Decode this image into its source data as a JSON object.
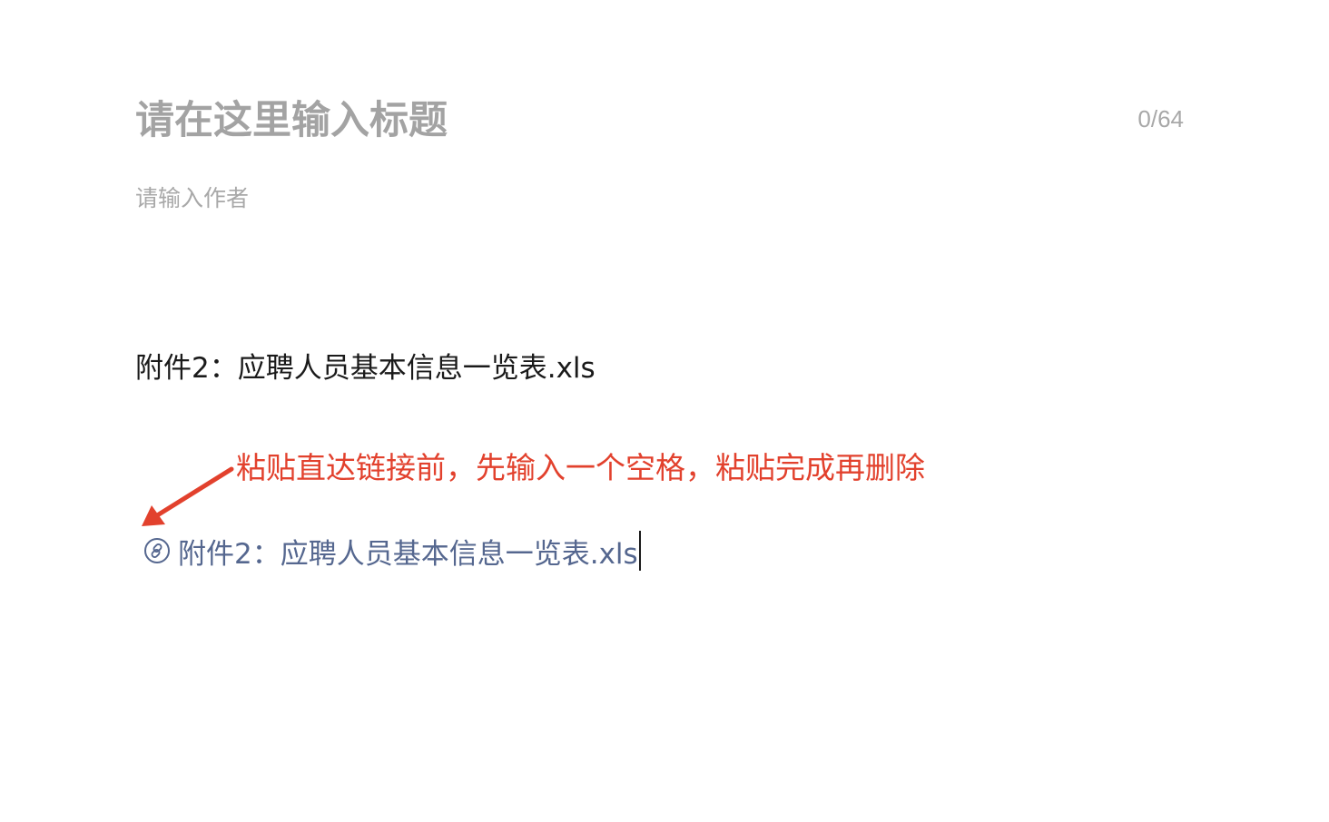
{
  "title_field": {
    "placeholder": "请在这里输入标题",
    "value": "",
    "counter": "0/64"
  },
  "author_field": {
    "placeholder": "请输入作者",
    "value": ""
  },
  "content": {
    "plain_attachment": "附件2：应聘人员基本信息一览表.xls",
    "annotation": "粘贴直达链接前，先输入一个空格，粘贴完成再删除",
    "link_attachment": {
      "icon": "link-icon",
      "text": "附件2：应聘人员基本信息一览表.xls"
    }
  },
  "colors": {
    "annotation": "#e2412d",
    "link": "#55678f",
    "placeholder": "#a3a3a3"
  }
}
